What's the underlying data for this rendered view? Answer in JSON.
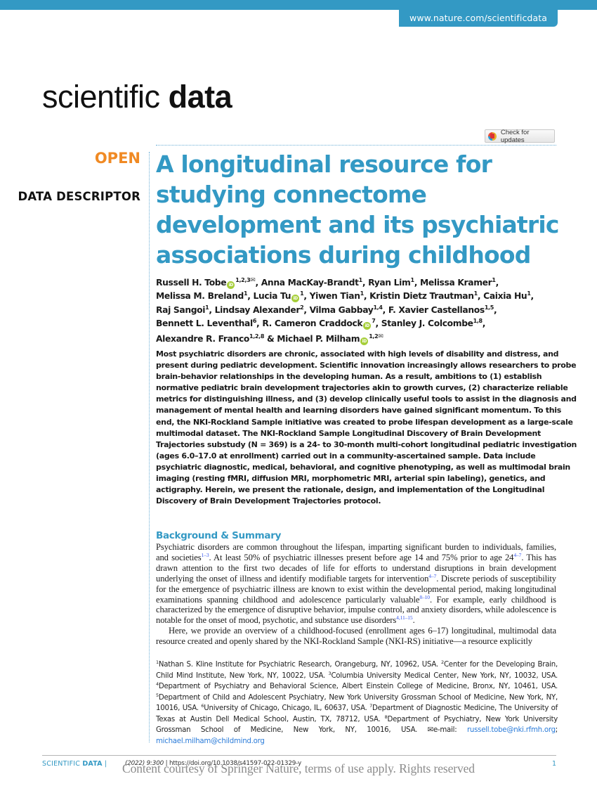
{
  "header": {
    "url": "www.nature.com/scientificdata",
    "brand_light": "scientific",
    "brand_bold": "data",
    "check_updates_label": "Check for updates"
  },
  "article": {
    "access_label": "OPEN",
    "type_label": "DATA DESCRIPTOR",
    "title": "A longitudinal resource for studying connectome development and its psychiatric associations during childhood",
    "authors": [
      {
        "name": "Russell H. Tobe",
        "orcid": true,
        "affil": "1,2,3",
        "email": true
      },
      {
        "name": "Anna MacKay-Brandt",
        "orcid": false,
        "affil": "1",
        "email": false
      },
      {
        "name": "Ryan Lim",
        "orcid": false,
        "affil": "1",
        "email": false
      },
      {
        "name": "Melissa Kramer",
        "orcid": false,
        "affil": "1",
        "email": false
      },
      {
        "name": "Melissa M. Breland",
        "orcid": false,
        "affil": "1",
        "email": false
      },
      {
        "name": "Lucia Tu",
        "orcid": true,
        "affil": "1",
        "email": false
      },
      {
        "name": "Yiwen Tian",
        "orcid": false,
        "affil": "1",
        "email": false
      },
      {
        "name": "Kristin Dietz Trautman",
        "orcid": false,
        "affil": "1",
        "email": false
      },
      {
        "name": "Caixia Hu",
        "orcid": false,
        "affil": "1",
        "email": false
      },
      {
        "name": "Raj Sangoi",
        "orcid": false,
        "affil": "1",
        "email": false
      },
      {
        "name": "Lindsay Alexander",
        "orcid": false,
        "affil": "2",
        "email": false
      },
      {
        "name": "Vilma Gabbay",
        "orcid": false,
        "affil": "1,4",
        "email": false
      },
      {
        "name": "F. Xavier Castellanos",
        "orcid": false,
        "affil": "1,5",
        "email": false
      },
      {
        "name": "Bennett L. Leventhal",
        "orcid": false,
        "affil": "6",
        "email": false
      },
      {
        "name": "R. Cameron Craddock",
        "orcid": true,
        "affil": "7",
        "email": false
      },
      {
        "name": "Stanley J. Colcombe",
        "orcid": false,
        "affil": "1,8",
        "email": false
      },
      {
        "name": "Alexandre R. Franco",
        "orcid": false,
        "affil": "1,2,8",
        "email": false
      },
      {
        "name": "Michael P. Milham",
        "orcid": true,
        "affil": "1,2",
        "email": true
      }
    ],
    "abstract": "Most psychiatric disorders are chronic, associated with high levels of disability and distress, and present during pediatric development. Scientific innovation increasingly allows researchers to probe brain-behavior relationships in the developing human. As a result, ambitions to (1) establish normative pediatric brain development trajectories akin to growth curves, (2) characterize reliable metrics for distinguishing illness, and (3) develop clinically useful tools to assist in the diagnosis and management of mental health and learning disorders have gained significant momentum. To this end, the NKI-Rockland Sample initiative was created to probe lifespan development as a large-scale multimodal dataset. The NKI-Rockland Sample Longitudinal Discovery of Brain Development Trajectories substudy (N = 369) is a 24- to 30-month multi-cohort longitudinal pediatric investigation (ages 6.0–17.0 at enrollment) carried out in a community-ascertained sample. Data include psychiatric diagnostic, medical, behavioral, and cognitive phenotyping, as well as multimodal brain imaging (resting fMRI, diffusion MRI, morphometric MRI, arterial spin labeling), genetics, and actigraphy. Herein, we present the rationale, design, and implementation of the Longitudinal Discovery of Brain Development Trajectories protocol.",
    "section_heading": "Background & Summary",
    "body": {
      "p1_segments": [
        {
          "text": "Psychiatric disorders are common throughout the lifespan, imparting significant burden to individuals, families, and societies"
        },
        {
          "ref": "1–3"
        },
        {
          "text": ". At least 50% of psychiatric illnesses present before age 14 and 75% prior to age 24"
        },
        {
          "ref": "4–7"
        },
        {
          "text": ". This has drawn attention to the first two decades of life for efforts to understand disruptions in brain development underlying the onset of illness and identify modifiable targets for intervention"
        },
        {
          "ref": "4–7"
        },
        {
          "text": ". Discrete periods of susceptibility for the emergence of psychiatric illness are known to exist within the developmental period, making longitudinal examinations spanning childhood and adolescence particularly valuable"
        },
        {
          "ref": "8–10"
        },
        {
          "text": ". For example, early childhood is characterized by the emergence of disruptive behavior, impulse control, and anxiety disorders, while adolescence is notable for the onset of mood, psychotic, and substance use disorders"
        },
        {
          "ref": "4,11–15"
        },
        {
          "text": "."
        }
      ],
      "p2": "Here, we provide an overview of a childhood-focused (enrollment ages 6–17) longitudinal, multimodal data resource created and openly shared by the NKI-Rockland Sample (NKI-RS) initiative—a resource explicitly"
    },
    "affiliations": [
      {
        "n": "1",
        "text": "Nathan S. Kline Institute for Psychiatric Research, Orangeburg, NY, 10962, USA. "
      },
      {
        "n": "2",
        "text": "Center for the Developing Brain, Child Mind Institute, New York, NY, 10022, USA. "
      },
      {
        "n": "3",
        "text": "Columbia University Medical Center, New York, NY, 10032, USA. "
      },
      {
        "n": "4",
        "text": "Department of Psychiatry and Behavioral Science, Albert Einstein College of Medicine, Bronx, NY, 10461, USA. "
      },
      {
        "n": "5",
        "text": "Department of Child and Adolescent Psychiatry, New York University Grossman School of Medicine, New York, NY, 10016, USA. "
      },
      {
        "n": "6",
        "text": "University of Chicago, Chicago, IL, 60637, USA. "
      },
      {
        "n": "7",
        "text": "Department of Diagnostic Medicine, The University of Texas at Austin Dell Medical School, Austin, TX, 78712, USA. "
      },
      {
        "n": "8",
        "text": "Department of Psychiatry, New York University Grossman School of Medicine, New York, NY, 10016, USA. "
      }
    ],
    "email_label": "e-mail: ",
    "emails": [
      "russell.tobe@nki.rfmh.org",
      "michael.milham@childmind.org"
    ],
    "email_separator": "; "
  },
  "footer": {
    "journal_light": "SCIENTIFIC ",
    "journal_bold": "DATA",
    "separator": " |",
    "citation_year_vol": "(2022) 9:300",
    "doi_text": " | https://doi.org/10.1038/s41597-022-01329-y",
    "page_number": "1",
    "watermark": "Content courtesy of Springer Nature, terms of use apply. Rights reserved"
  },
  "colors": {
    "brand_blue": "#3399c4",
    "open_orange": "#f08a24",
    "orcid_green": "#a6ce39",
    "ref_blue": "#3355ee"
  }
}
